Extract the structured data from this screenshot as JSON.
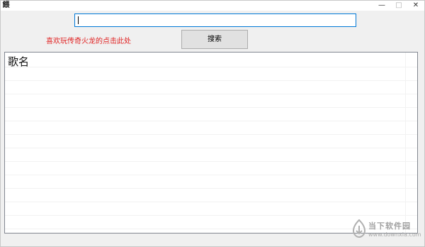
{
  "window": {
    "title_icon_glyph": "餵",
    "minimize_glyph": "—",
    "maximize_glyph": "□",
    "close_glyph": "✕"
  },
  "search": {
    "value": "",
    "placeholder": ""
  },
  "promo": {
    "text": "喜欢玩传奇火龙的点击此处",
    "color": "#e02020"
  },
  "search_button": {
    "label": "搜索"
  },
  "results": {
    "columns": [
      "歌名"
    ],
    "rows": []
  },
  "watermark": {
    "name": "当下软件园",
    "url": "www.downxia.com"
  },
  "colors": {
    "accent": "#0078d7",
    "link_red": "#e02020"
  }
}
